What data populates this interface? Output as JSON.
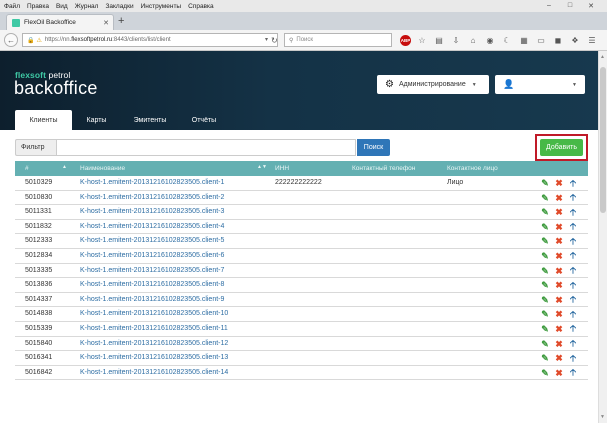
{
  "browser": {
    "menu": [
      "Файл",
      "Правка",
      "Вид",
      "Журнал",
      "Закладки",
      "Инструменты",
      "Справка"
    ],
    "tab_title": "FlexOil Backoffice",
    "url_prefix": "https://nn.",
    "url_domain": "flexsoftpetrol.ru",
    "url_path": ":8443/clients/list/client",
    "search_placeholder": "Поиск",
    "adblock_label": "ABP"
  },
  "app": {
    "brand": "flexsoft",
    "brand_suffix": " petrol",
    "title": "backoffice",
    "admin_label": "Администрирование",
    "tabs": [
      "Клиенты",
      "Карты",
      "Эмитенты",
      "Отчёты"
    ],
    "active_tab": 0
  },
  "filter": {
    "label": "Фильтр",
    "value": "",
    "search_label": "Поиск",
    "add_label": "Добавить"
  },
  "table": {
    "columns": [
      "#",
      "Наименование",
      "ИНН",
      "Контактный телефон",
      "Контактное лицо"
    ],
    "rows": [
      {
        "id": "5010329",
        "name": "K-host-1.emitent-20131216102823505.client-1",
        "inn": "222222222222",
        "phone": "",
        "contact": "Лицо"
      },
      {
        "id": "5010830",
        "name": "K-host-1.emitent-20131216102823505.client-2",
        "inn": "",
        "phone": "",
        "contact": ""
      },
      {
        "id": "5011331",
        "name": "K-host-1.emitent-20131216102823505.client-3",
        "inn": "",
        "phone": "",
        "contact": ""
      },
      {
        "id": "5011832",
        "name": "K-host-1.emitent-20131216102823505.client-4",
        "inn": "",
        "phone": "",
        "contact": ""
      },
      {
        "id": "5012333",
        "name": "K-host-1.emitent-20131216102823505.client-5",
        "inn": "",
        "phone": "",
        "contact": ""
      },
      {
        "id": "5012834",
        "name": "K-host-1.emitent-20131216102823505.client-6",
        "inn": "",
        "phone": "",
        "contact": ""
      },
      {
        "id": "5013335",
        "name": "K-host-1.emitent-20131216102823505.client-7",
        "inn": "",
        "phone": "",
        "contact": ""
      },
      {
        "id": "5013836",
        "name": "K-host-1.emitent-20131216102823505.client-8",
        "inn": "",
        "phone": "",
        "contact": ""
      },
      {
        "id": "5014337",
        "name": "K-host-1.emitent-20131216102823505.client-9",
        "inn": "",
        "phone": "",
        "contact": ""
      },
      {
        "id": "5014838",
        "name": "K-host-1.emitent-20131216102823505.client-10",
        "inn": "",
        "phone": "",
        "contact": ""
      },
      {
        "id": "5015339",
        "name": "K-host-1.emitent-20131216102823505.client-11",
        "inn": "",
        "phone": "",
        "contact": ""
      },
      {
        "id": "5015840",
        "name": "K-host-1.emitent-20131216102823505.client-12",
        "inn": "",
        "phone": "",
        "contact": ""
      },
      {
        "id": "5016341",
        "name": "K-host-1.emitent-20131216102823505.client-13",
        "inn": "",
        "phone": "",
        "contact": ""
      },
      {
        "id": "5016842",
        "name": "K-host-1.emitent-20131216102823505.client-14",
        "inn": "",
        "phone": "",
        "contact": ""
      }
    ]
  },
  "colors": {
    "header_bg": "#143246",
    "brand_accent": "#3fc9a5",
    "table_header": "#64b0b2",
    "link": "#2d6da3",
    "add_button": "#47b947",
    "search_button": "#2f76b8",
    "highlight_outline": "#c01a28"
  }
}
